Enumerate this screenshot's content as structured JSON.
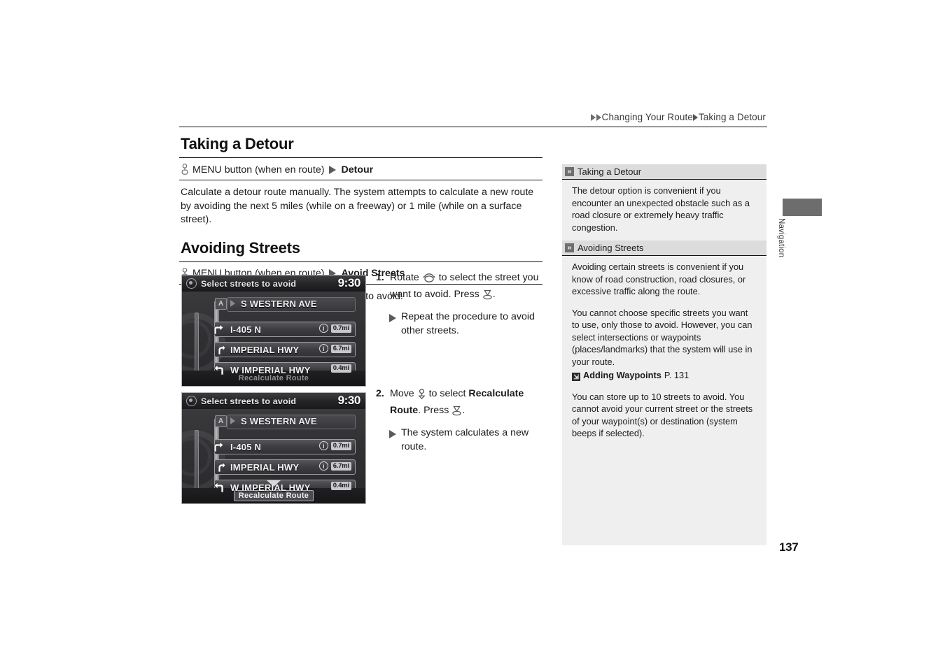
{
  "page": {
    "number": "137",
    "side_tab_label": "Navigation"
  },
  "breadcrumb": {
    "part1": "Changing Your Route",
    "part2": "Taking a Detour"
  },
  "sections": [
    {
      "id": "taking-a-detour",
      "title": "Taking a Detour",
      "command_prefix": "MENU button (when en route)",
      "command_target": "Detour",
      "body": "Calculate a detour route manually. The system attempts to calculate a new route by avoiding the next 5 miles (while on a freeway) or 1 mile (while on a surface street)."
    },
    {
      "id": "avoiding-streets",
      "title": "Avoiding Streets",
      "command_prefix": "MENU button (when en route)",
      "command_target": "Avoid Streets",
      "body": "Select a street or streets along your route to avoid."
    }
  ],
  "steps": [
    {
      "number": "1.",
      "text_before_dial": "Rotate",
      "text_after_dial": "to select the street you want to avoid. Press",
      "text_end": ".",
      "substep": "Repeat the procedure to avoid other streets."
    },
    {
      "number": "2.",
      "text_before_dial": "Move",
      "text_after_dial": "to select",
      "bold_target": "Recalculate Route",
      "text_end": ". Press",
      "text_final": ".",
      "substep": "The system calculates a new route."
    }
  ],
  "nav_screens": [
    {
      "id": "screen-1",
      "title": "Select streets to avoid",
      "clock": "9:30",
      "header_row": {
        "badge": "A",
        "label": "S WESTERN AVE"
      },
      "rows": [
        {
          "label": "I-405 N",
          "icon": "turn-right-icon",
          "info": "i",
          "distance": "0.7mi",
          "has_info": true
        },
        {
          "label": "IMPERIAL HWY",
          "icon": "turn-slight-left-icon",
          "info": "i",
          "distance": "6.7mi",
          "has_info": true
        },
        {
          "label": "W IMPERIAL HWY",
          "icon": "turn-left-icon",
          "info": "",
          "distance": "0.4mi",
          "has_info": false
        }
      ],
      "footer": "Recalculate Route",
      "footer_selected": false,
      "show_down_caret": false
    },
    {
      "id": "screen-2",
      "title": "Select streets to avoid",
      "clock": "9:30",
      "header_row": {
        "badge": "A",
        "label": "S WESTERN AVE"
      },
      "rows": [
        {
          "label": "I-405 N",
          "icon": "turn-right-icon",
          "info": "i",
          "distance": "0.7mi",
          "has_info": true
        },
        {
          "label": "IMPERIAL HWY",
          "icon": "turn-slight-left-icon",
          "info": "i",
          "distance": "6.7mi",
          "has_info": true
        },
        {
          "label": "W IMPERIAL HWY",
          "icon": "turn-left-icon",
          "info": "",
          "distance": "0.4mi",
          "has_info": false
        }
      ],
      "footer": "Recalculate Route",
      "footer_selected": true,
      "show_down_caret": true
    }
  ],
  "sidebar": {
    "notes": [
      {
        "heading": "Taking a Detour",
        "paragraphs": [
          "The detour option is convenient if you encounter an unexpected obstacle such as a road closure or extremely heavy traffic congestion."
        ],
        "xref": null
      },
      {
        "heading": "Avoiding Streets",
        "paragraphs": [
          "Avoiding certain streets is convenient if you know of road construction, road closures, or excessive traffic along the route.",
          "You cannot choose specific streets you want to use, only those to avoid. However, you can select intersections or waypoints (places/landmarks) that the system will use in your route."
        ],
        "xref": {
          "label": "Adding Waypoints",
          "page": "P. 131"
        },
        "paragraphs_after": [
          "You can store up to 10 streets to avoid. You cannot avoid your current street or the streets of your waypoint(s) or destination (system beeps if selected)."
        ]
      }
    ]
  },
  "colors": {
    "rule": "#111111",
    "note_header_bg": "#dcdcdc",
    "note_bg": "#efefef",
    "tab_block": "#6d6d6d"
  }
}
